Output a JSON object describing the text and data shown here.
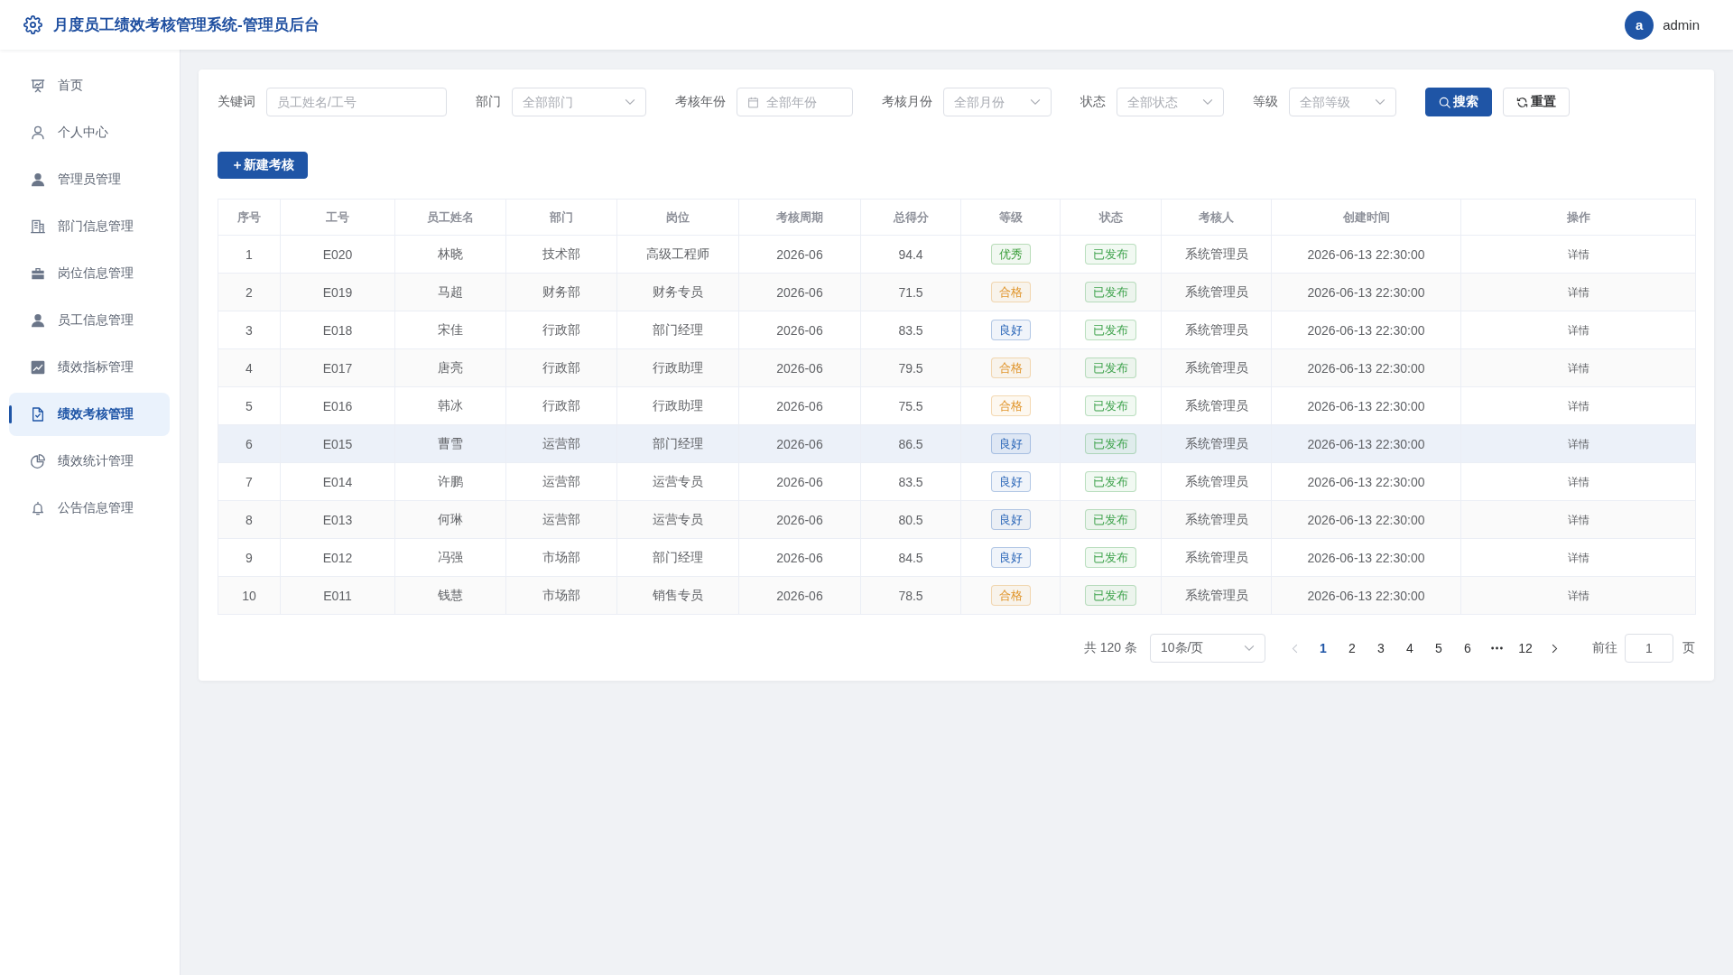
{
  "header": {
    "title": "月度员工绩效考核管理系统-管理员后台",
    "avatar_letter": "a",
    "username": "admin"
  },
  "sidebar": {
    "items": [
      {
        "label": "首页",
        "selected": false
      },
      {
        "label": "个人中心",
        "selected": false
      },
      {
        "label": "管理员管理",
        "selected": false
      },
      {
        "label": "部门信息管理",
        "selected": false
      },
      {
        "label": "岗位信息管理",
        "selected": false
      },
      {
        "label": "员工信息管理",
        "selected": false
      },
      {
        "label": "绩效指标管理",
        "selected": false
      },
      {
        "label": "绩效考核管理",
        "selected": true
      },
      {
        "label": "绩效统计管理",
        "selected": false
      },
      {
        "label": "公告信息管理",
        "selected": false
      }
    ]
  },
  "filters": [
    {
      "kind": "text",
      "label": "关键词",
      "placeholder": "员工姓名/工号"
    },
    {
      "kind": "select",
      "label": "部门",
      "placeholder": "全部部门"
    },
    {
      "kind": "date",
      "label": "考核年份",
      "placeholder": "全部年份"
    },
    {
      "kind": "select",
      "label": "考核月份",
      "placeholder": "全部月份"
    },
    {
      "kind": "select",
      "label": "状态",
      "placeholder": "全部状态"
    },
    {
      "kind": "select",
      "label": "等级",
      "placeholder": "全部等级"
    }
  ],
  "filter_buttons": [
    {
      "kind": "primary",
      "label": "搜索"
    },
    {
      "kind": "default",
      "label": "重置"
    }
  ],
  "create_button": {
    "label": "＋新建考核"
  },
  "table": {
    "columns": [
      "序号",
      "工号",
      "员工姓名",
      "部门",
      "岗位",
      "考核周期",
      "总得分",
      "等级",
      "状态",
      "考核人",
      "创建时间",
      "操作"
    ],
    "rows": [
      {
        "no": "1",
        "emp_id": "E020",
        "name": "林晓",
        "dept": "技术部",
        "position": "高级工程师",
        "period": "2026-06",
        "score": "94.4",
        "grade": {
          "text": "优秀",
          "color": "#3e9f3e"
        },
        "status": {
          "text": "已发布",
          "color": "#3fa34d"
        },
        "reviewer": "系统管理员",
        "created": "2026-06-13 22:30:00",
        "action": "详情",
        "hovered": false
      },
      {
        "no": "2",
        "emp_id": "E019",
        "name": "马超",
        "dept": "财务部",
        "position": "财务专员",
        "period": "2026-06",
        "score": "71.5",
        "grade": {
          "text": "合格",
          "color": "#e0952b"
        },
        "status": {
          "text": "已发布",
          "color": "#3fa34d"
        },
        "reviewer": "系统管理员",
        "created": "2026-06-13 22:30:00",
        "action": "详情",
        "hovered": false
      },
      {
        "no": "3",
        "emp_id": "E018",
        "name": "宋佳",
        "dept": "行政部",
        "position": "部门经理",
        "period": "2026-06",
        "score": "83.5",
        "grade": {
          "text": "良好",
          "color": "#2a66b8"
        },
        "status": {
          "text": "已发布",
          "color": "#3fa34d"
        },
        "reviewer": "系统管理员",
        "created": "2026-06-13 22:30:00",
        "action": "详情",
        "hovered": false
      },
      {
        "no": "4",
        "emp_id": "E017",
        "name": "唐亮",
        "dept": "行政部",
        "position": "行政助理",
        "period": "2026-06",
        "score": "79.5",
        "grade": {
          "text": "合格",
          "color": "#e0952b"
        },
        "status": {
          "text": "已发布",
          "color": "#3fa34d"
        },
        "reviewer": "系统管理员",
        "created": "2026-06-13 22:30:00",
        "action": "详情",
        "hovered": false
      },
      {
        "no": "5",
        "emp_id": "E016",
        "name": "韩冰",
        "dept": "行政部",
        "position": "行政助理",
        "period": "2026-06",
        "score": "75.5",
        "grade": {
          "text": "合格",
          "color": "#e0952b"
        },
        "status": {
          "text": "已发布",
          "color": "#3fa34d"
        },
        "reviewer": "系统管理员",
        "created": "2026-06-13 22:30:00",
        "action": "详情",
        "hovered": false
      },
      {
        "no": "6",
        "emp_id": "E015",
        "name": "曹雪",
        "dept": "运营部",
        "position": "部门经理",
        "period": "2026-06",
        "score": "86.5",
        "grade": {
          "text": "良好",
          "color": "#2a66b8"
        },
        "status": {
          "text": "已发布",
          "color": "#3fa34d"
        },
        "reviewer": "系统管理员",
        "created": "2026-06-13 22:30:00",
        "action": "详情",
        "hovered": true
      },
      {
        "no": "7",
        "emp_id": "E014",
        "name": "许鹏",
        "dept": "运营部",
        "position": "运营专员",
        "period": "2026-06",
        "score": "83.5",
        "grade": {
          "text": "良好",
          "color": "#2a66b8"
        },
        "status": {
          "text": "已发布",
          "color": "#3fa34d"
        },
        "reviewer": "系统管理员",
        "created": "2026-06-13 22:30:00",
        "action": "详情",
        "hovered": false
      },
      {
        "no": "8",
        "emp_id": "E013",
        "name": "何琳",
        "dept": "运营部",
        "position": "运营专员",
        "period": "2026-06",
        "score": "80.5",
        "grade": {
          "text": "良好",
          "color": "#2a66b8"
        },
        "status": {
          "text": "已发布",
          "color": "#3fa34d"
        },
        "reviewer": "系统管理员",
        "created": "2026-06-13 22:30:00",
        "action": "详情",
        "hovered": false
      },
      {
        "no": "9",
        "emp_id": "E012",
        "name": "冯强",
        "dept": "市场部",
        "position": "部门经理",
        "period": "2026-06",
        "score": "84.5",
        "grade": {
          "text": "良好",
          "color": "#2a66b8"
        },
        "status": {
          "text": "已发布",
          "color": "#3fa34d"
        },
        "reviewer": "系统管理员",
        "created": "2026-06-13 22:30:00",
        "action": "详情",
        "hovered": false
      },
      {
        "no": "10",
        "emp_id": "E011",
        "name": "钱慧",
        "dept": "市场部",
        "position": "销售专员",
        "period": "2026-06",
        "score": "78.5",
        "grade": {
          "text": "合格",
          "color": "#e0952b"
        },
        "status": {
          "text": "已发布",
          "color": "#3fa34d"
        },
        "reviewer": "系统管理员",
        "created": "2026-06-13 22:30:00",
        "action": "详情",
        "hovered": false
      }
    ]
  },
  "pagination": {
    "total": "共 120 条",
    "page_size": "10条/页",
    "prev": {
      "disabled": true
    },
    "pages": [
      {
        "kind": "page",
        "label": "1",
        "selected": true
      },
      {
        "kind": "page",
        "label": "2",
        "selected": false
      },
      {
        "kind": "page",
        "label": "3",
        "selected": false
      },
      {
        "kind": "page",
        "label": "4",
        "selected": false
      },
      {
        "kind": "page",
        "label": "5",
        "selected": false
      },
      {
        "kind": "page",
        "label": "6",
        "selected": false
      },
      {
        "kind": "more",
        "selected": false
      },
      {
        "kind": "page",
        "label": "12",
        "selected": false
      }
    ],
    "next": {
      "disabled": false
    },
    "goto": {
      "prefix": "前往",
      "value": "1",
      "suffix": "页"
    }
  }
}
